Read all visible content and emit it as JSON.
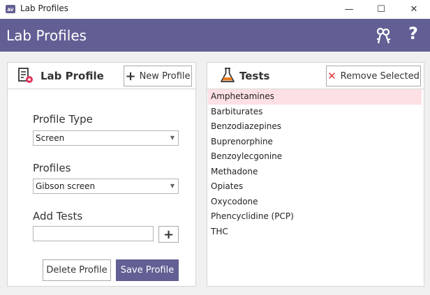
{
  "window": {
    "title": "Lab Profiles",
    "controls": {
      "minimize": "—",
      "maximize": "☐",
      "close": "✕"
    }
  },
  "header": {
    "title": "Lab Profiles",
    "help": "?"
  },
  "lab_profile": {
    "title": "Lab Profile",
    "new_profile_label": "New Profile",
    "profile_type_label": "Profile Type",
    "profile_type_value": "Screen",
    "profiles_label": "Profiles",
    "profiles_value": "Gibson screen",
    "add_tests_label": "Add Tests",
    "add_tests_value": "",
    "add_button": "+",
    "delete_label": "Delete Profile",
    "save_label": "Save Profile"
  },
  "tests_panel": {
    "title": "Tests",
    "remove_label": "Remove Selected",
    "items": [
      "Amphetamines",
      "Barbiturates",
      "Benzodiazepines",
      "Buprenorphine",
      "Benzoylecgonine",
      "Methadone",
      "Opiates",
      "Oxycodone",
      "Phencyclidine (PCP)",
      "THC"
    ],
    "selected_index": 0
  },
  "colors": {
    "accent": "#625f94",
    "selected_row": "#fde0e4",
    "remove_icon": "#e0373a",
    "gear": "#e0375f"
  }
}
